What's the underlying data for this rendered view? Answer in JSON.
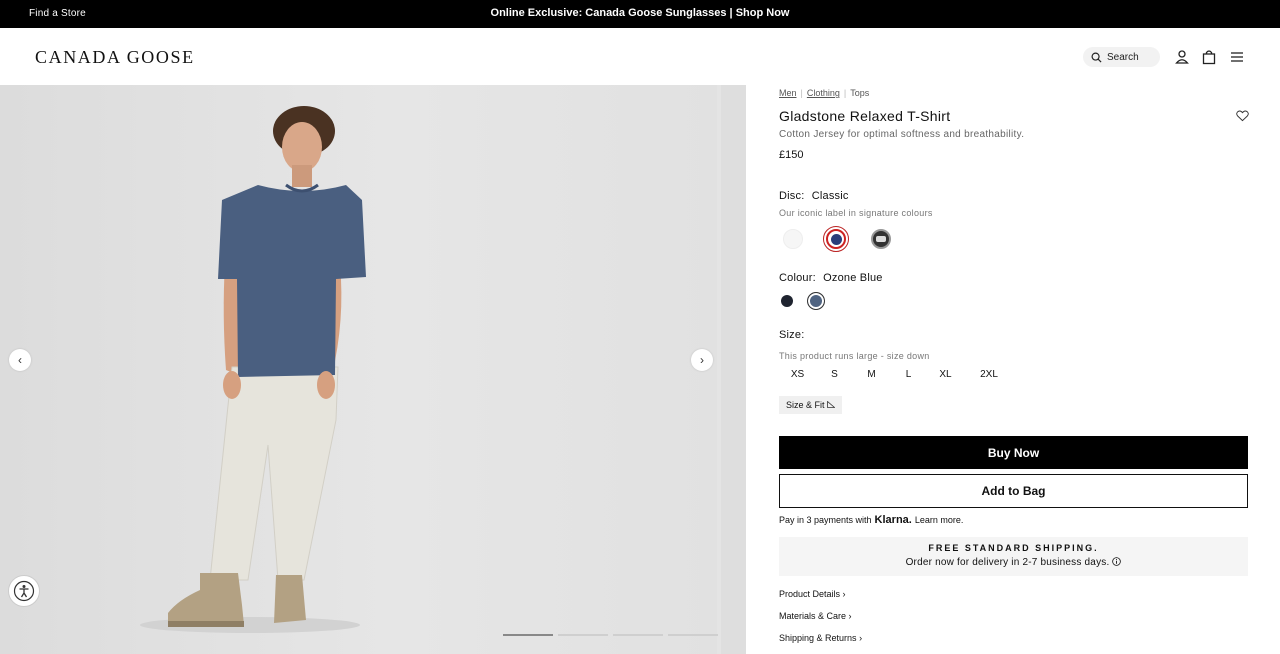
{
  "topbar": {
    "find_store": "Find a Store",
    "promo": "Online Exclusive: Canada Goose Sunglasses | Shop Now"
  },
  "header": {
    "logo": "CANADA GOOSE",
    "search_label": "Search",
    "icons": [
      "search-icon",
      "account-icon",
      "bag-icon",
      "menu-icon"
    ]
  },
  "gallery": {
    "prev_arrow": "‹",
    "next_arrow": "›",
    "dot_count": 4,
    "active_dot": 0
  },
  "product": {
    "breadcrumb": [
      "Men",
      "Clothing",
      "Tops"
    ],
    "title": "Gladstone Relaxed T-Shirt",
    "description": "Cotton Jersey for optimal softness and breathability.",
    "price": "£150",
    "disc_label": "Disc:",
    "disc_value": "Classic",
    "disc_sub": "Our iconic label in signature colours",
    "discs": [
      "white-disc",
      "classic-disc",
      "black-disc"
    ],
    "colour_label": "Colour:",
    "colour_value": "Ozone Blue",
    "colours": [
      {
        "name": "Navy",
        "hex": "#1f2430"
      },
      {
        "name": "Ozone Blue",
        "hex": "#4f6381"
      }
    ],
    "size_label": "Size:",
    "size_note": "This product runs large - size down",
    "sizes": [
      "XS",
      "S",
      "M",
      "L",
      "XL",
      "2XL"
    ],
    "size_fit": "Size & Fit",
    "buy_now": "Buy Now",
    "add_to_bag": "Add to Bag",
    "klarna_pre": "Pay in 3 payments with",
    "klarna_brand": "Klarna.",
    "klarna_link": "Learn more.",
    "shipping_head": "FREE STANDARD SHIPPING.",
    "shipping_sub": "Order now for delivery in 2-7 business days.",
    "accordions": [
      "Product Details",
      "Materials & Care",
      "Shipping & Returns"
    ]
  },
  "colors": {
    "accent": "#000000",
    "tshirt": "#4a5f80",
    "trousers": "#e6e4dc",
    "boots": "#b3a183"
  }
}
